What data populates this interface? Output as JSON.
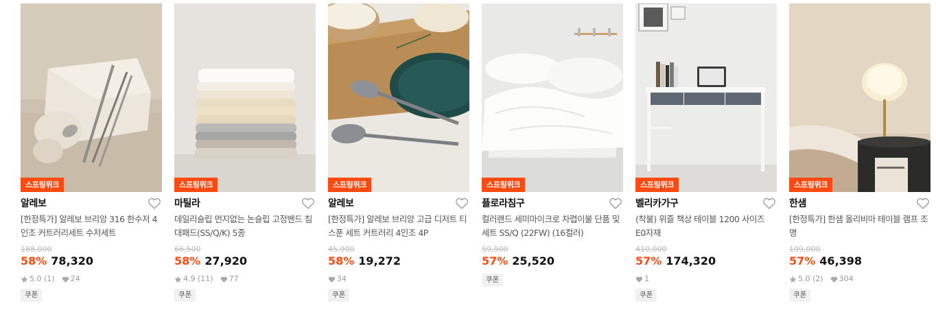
{
  "colors": {
    "accent": "#ff4b12",
    "text_primary": "#111111",
    "text_secondary": "#555555",
    "text_muted": "#9a9a9a"
  },
  "products": [
    {
      "promo_badge": "스프링위크",
      "brand": "알레보",
      "title": "[한정특가] 알레보 브리앙 316 한수저 4인조 커트러리세트 수저세트",
      "original_price": "188,000",
      "discount": "58%",
      "price": "78,320",
      "rating": "5.0",
      "review_count": "(1)",
      "likes": "24",
      "coupon": "쿠폰",
      "image": "cutlery-on-stone"
    },
    {
      "promo_badge": "스프링위크",
      "brand": "마틸라",
      "title": "데일리슬립 먼지없는 논슬립 고정밴드 침대패드(SS/Q/K) 5종",
      "original_price": "66,500",
      "discount": "58%",
      "price": "27,920",
      "rating": "4.9",
      "review_count": "(11)",
      "likes": "77",
      "coupon": "쿠폰",
      "image": "folded-pads-stack"
    },
    {
      "promo_badge": "스프링위크",
      "brand": "알레보",
      "title": "[한정특가] 알레보 브리앙 고급 디저트 티스푼 세트 커트러리 4인조 4P",
      "original_price": "45,900",
      "discount": "58%",
      "price": "19,272",
      "rating": "",
      "review_count": "",
      "likes": "34",
      "coupon": "쿠폰",
      "image": "spoons-on-cutting-board"
    },
    {
      "promo_badge": "스프링위크",
      "brand": "플로라침구",
      "title": "컬러랜드 세미마이크로 차렵이불 단품 및 세트 SS/Q (22FW) (16컬러)",
      "original_price": "59,900",
      "discount": "57%",
      "price": "25,520",
      "rating": "",
      "review_count": "",
      "likes": "",
      "coupon": "쿠폰",
      "image": "white-bedding"
    },
    {
      "promo_badge": "스프링위크",
      "brand": "벨리카가구",
      "title": "(착불) 위즐 책상 테이블 1200 사이즈 E0자재",
      "original_price": "410,000",
      "discount": "57%",
      "price": "174,320",
      "rating": "",
      "review_count": "",
      "likes": "1",
      "coupon": "쿠폰",
      "image": "white-desk"
    },
    {
      "promo_badge": "스프링위크",
      "brand": "한샘",
      "title": "[한정특가] 한샘 올리비아 테이블 램프 조명",
      "original_price": "109,000",
      "discount": "57%",
      "price": "46,398",
      "rating": "5.0",
      "review_count": "(2)",
      "likes": "304",
      "coupon": "쿠폰",
      "image": "table-lamp"
    }
  ]
}
